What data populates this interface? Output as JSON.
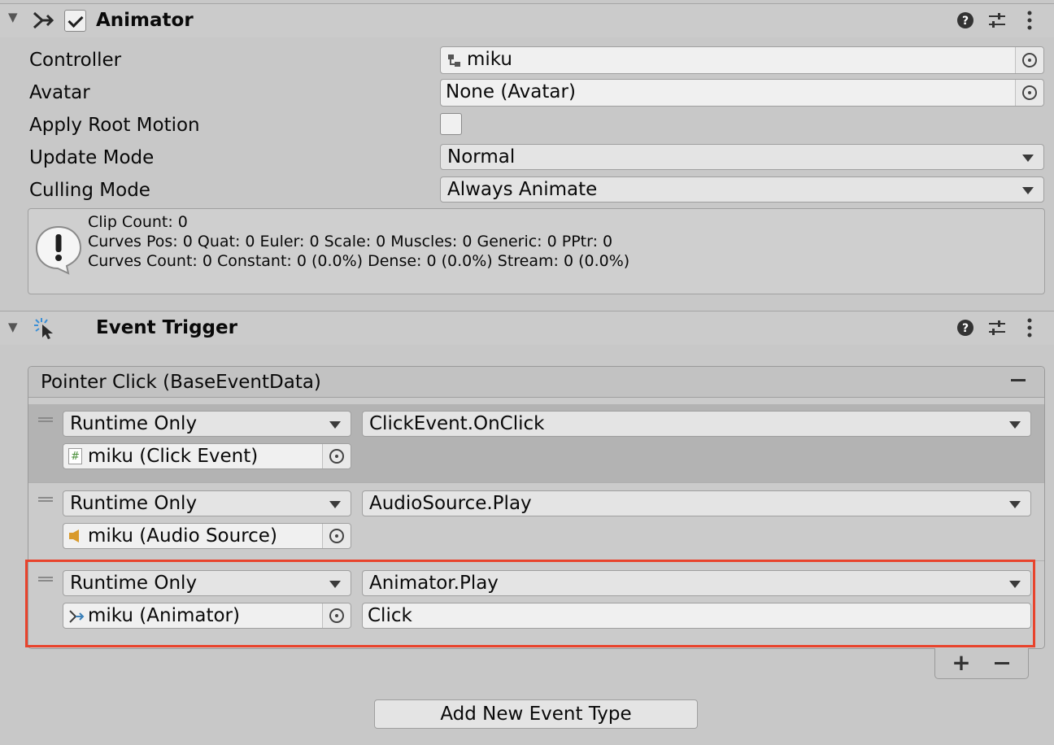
{
  "animator": {
    "title": "Animator",
    "enabled": true,
    "header_icons": [
      "help-icon",
      "presets-icon",
      "more-icon"
    ],
    "fields": {
      "controller": {
        "label": "Controller",
        "value": "miku",
        "icon": "animator-controller-icon"
      },
      "avatar": {
        "label": "Avatar",
        "value": "None (Avatar)"
      },
      "apply_root_motion": {
        "label": "Apply Root Motion",
        "checked": false
      },
      "update_mode": {
        "label": "Update Mode",
        "value": "Normal"
      },
      "culling_mode": {
        "label": "Culling Mode",
        "value": "Always Animate"
      }
    },
    "info": {
      "line1": "Clip Count: 0",
      "line2": "Curves Pos: 0 Quat: 0 Euler: 0 Scale: 0 Muscles: 0 Generic: 0 PPtr: 0",
      "line3": "Curves Count: 0 Constant: 0 (0.0%) Dense: 0 (0.0%) Stream: 0 (0.0%)"
    }
  },
  "event_trigger": {
    "title": "Event Trigger",
    "event_header": "Pointer Click (BaseEventData)",
    "entries": [
      {
        "mode": "Runtime Only",
        "function": "ClickEvent.OnClick",
        "target": "miku (Click Event)",
        "target_icon": "script-icon",
        "argument": null
      },
      {
        "mode": "Runtime Only",
        "function": "AudioSource.Play",
        "target": "miku (Audio Source)",
        "target_icon": "audio-source-icon",
        "argument": null
      },
      {
        "mode": "Runtime Only",
        "function": "Animator.Play",
        "target": "miku (Animator)",
        "target_icon": "animator-icon",
        "argument": "Click"
      }
    ],
    "add_new_label": "Add New Event Type",
    "highlight_color": "#e8432c"
  }
}
